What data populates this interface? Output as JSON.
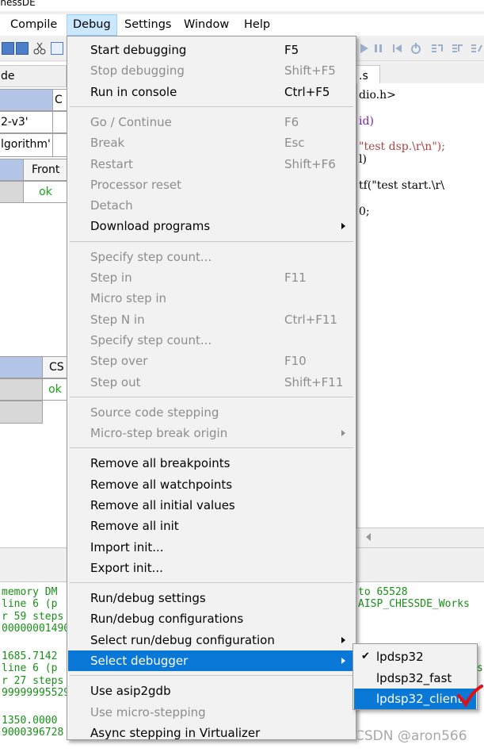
{
  "window": {
    "title_fragment": "ChessDE"
  },
  "menubar": [
    "Compile",
    "Debug",
    "Settings",
    "Window",
    "Help"
  ],
  "left_panel": {
    "tab_fragment": "de",
    "table1": {
      "header_cells": [
        "C"
      ],
      "rows": [
        "2-v3'",
        "lgorithm'"
      ]
    },
    "table2": {
      "headers": [
        "Front"
      ],
      "value": "ok"
    },
    "table3": {
      "headers": [
        "CS"
      ],
      "value": "ok"
    }
  },
  "editor": {
    "tab_fragment": ".s",
    "lines": [
      "dio.h>",
      "id)",
      "\"test dsp.\\r\\n\");",
      "l)",
      "tf(\"test start.\\r\\",
      "0;"
    ]
  },
  "console": {
    "lines": [
      {
        "left": " memory DM",
        "right": " to 65528"
      },
      {
        "left": " line 6 (p",
        "right": "AISP_CHESSDE_Works"
      },
      {
        "left": "r 59 steps",
        "right": ""
      },
      {
        "left": "00000001490",
        "right": ""
      },
      {
        "left": "",
        "right": ""
      },
      {
        "left": " 1685.7142",
        "right": ""
      },
      {
        "left": " line 6 (p",
        "right": ""
      },
      {
        "left": "r 27 steps",
        "right": "s"
      },
      {
        "left": "99999995529",
        "right": ""
      },
      {
        "left": "",
        "right": ""
      },
      {
        "left": " 1350.0000",
        "right": ""
      },
      {
        "left": "9000396728",
        "right": ""
      }
    ]
  },
  "debug_menu": {
    "groups": [
      [
        {
          "label": "Start debugging",
          "shortcut": "F5",
          "enabled": true
        },
        {
          "label": "Stop debugging",
          "shortcut": "Shift+F5",
          "enabled": false
        },
        {
          "label": "Run in console",
          "shortcut": "Ctrl+F5",
          "enabled": true
        }
      ],
      [
        {
          "label": "Go / Continue",
          "shortcut": "F6",
          "enabled": false
        },
        {
          "label": "Break",
          "shortcut": "Esc",
          "enabled": false
        },
        {
          "label": "Restart",
          "shortcut": "Shift+F6",
          "enabled": false
        },
        {
          "label": "Processor reset",
          "shortcut": "",
          "enabled": false
        },
        {
          "label": "Detach",
          "shortcut": "",
          "enabled": false
        },
        {
          "label": "Download programs",
          "shortcut": "",
          "enabled": true,
          "submenu": true
        }
      ],
      [
        {
          "label": "Specify step count...",
          "shortcut": "",
          "enabled": false
        },
        {
          "label": "Step in",
          "shortcut": "F11",
          "enabled": false
        },
        {
          "label": "Micro step in",
          "shortcut": "",
          "enabled": false
        },
        {
          "label": "Step N in",
          "shortcut": "Ctrl+F11",
          "enabled": false
        },
        {
          "label": "Specify step count...",
          "shortcut": "",
          "enabled": false
        },
        {
          "label": "Step over",
          "shortcut": "F10",
          "enabled": false
        },
        {
          "label": "Step out",
          "shortcut": "Shift+F11",
          "enabled": false
        }
      ],
      [
        {
          "label": "Source code stepping",
          "shortcut": "",
          "enabled": false
        },
        {
          "label": "Micro-step break origin",
          "shortcut": "",
          "enabled": false,
          "submenu": true
        }
      ],
      [
        {
          "label": "Remove all breakpoints",
          "shortcut": "",
          "enabled": true
        },
        {
          "label": "Remove all watchpoints",
          "shortcut": "",
          "enabled": true
        },
        {
          "label": "Remove all initial values",
          "shortcut": "",
          "enabled": true
        },
        {
          "label": "Remove all init",
          "shortcut": "",
          "enabled": true
        },
        {
          "label": "Import init...",
          "shortcut": "",
          "enabled": true
        },
        {
          "label": "Export init...",
          "shortcut": "",
          "enabled": true
        }
      ],
      [
        {
          "label": "Run/debug settings",
          "shortcut": "",
          "enabled": true
        },
        {
          "label": "Run/debug configurations",
          "shortcut": "",
          "enabled": true
        },
        {
          "label": "Select run/debug configuration",
          "shortcut": "",
          "enabled": true,
          "submenu": true
        },
        {
          "label": "Select debugger",
          "shortcut": "",
          "enabled": true,
          "submenu": true,
          "highlighted": true
        }
      ],
      [
        {
          "label": "Use asip2gdb",
          "shortcut": "",
          "enabled": true
        },
        {
          "label": "Use micro-stepping",
          "shortcut": "",
          "enabled": false
        },
        {
          "label": "Async stepping in Virtualizer",
          "shortcut": "",
          "enabled": true
        }
      ]
    ]
  },
  "debugger_submenu": [
    {
      "label": "lpdsp32",
      "checked": true,
      "highlighted": false
    },
    {
      "label": "lpdsp32_fast",
      "checked": false,
      "highlighted": false
    },
    {
      "label": "lpdsp32_client",
      "checked": false,
      "highlighted": true
    }
  ],
  "annotation": {
    "color": "#e01010"
  },
  "watermark": "CSDN @aron566",
  "colors": {
    "highlight": "#0a78d7",
    "header_blue": "#b4c6e7",
    "ok_green": "#16a516",
    "console_green": "#169016"
  }
}
